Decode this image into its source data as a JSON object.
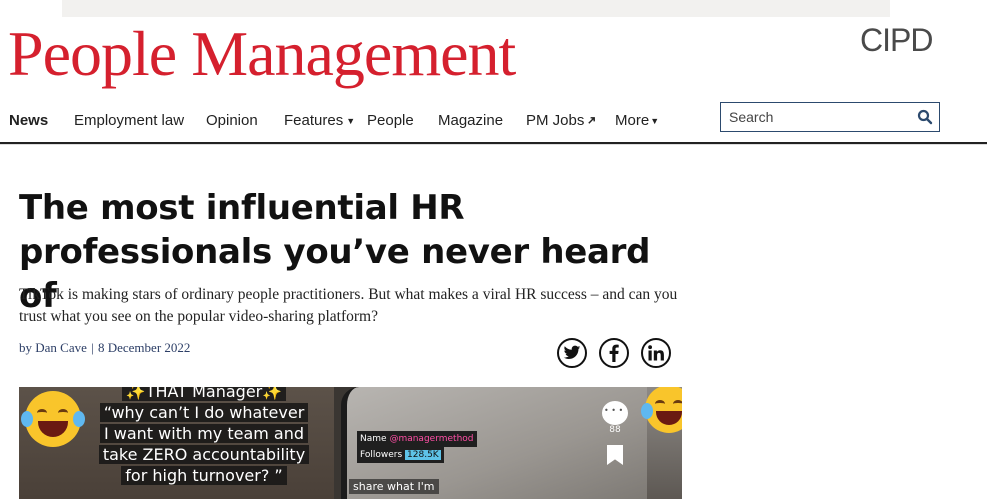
{
  "brand": {
    "logo_text": "People Management",
    "partner_logo": "CIPD",
    "logo_color": "#d5202e"
  },
  "nav": {
    "items": [
      {
        "label": "News",
        "active": true
      },
      {
        "label": "Employment law"
      },
      {
        "label": "Opinion"
      },
      {
        "label": "Features",
        "has_dropdown": true
      },
      {
        "label": "People"
      },
      {
        "label": "Magazine"
      },
      {
        "label": "PM Jobs",
        "icon": "external-link-icon"
      },
      {
        "label": "More",
        "has_dropdown": true
      }
    ]
  },
  "search": {
    "placeholder": "Search",
    "icon": "search-icon"
  },
  "article": {
    "title": "The most influential HR professionals you’ve never heard of",
    "standfirst": "TikTok is making stars of ordinary people practitioners. But what makes a viral HR success – and can you trust what you see on the popular video-sharing platform?",
    "byline_prefix": "by",
    "author": "Dan Cave",
    "date": "8 December 2022",
    "share": [
      {
        "network": "twitter",
        "icon": "twitter-icon"
      },
      {
        "network": "facebook",
        "icon": "facebook-icon"
      },
      {
        "network": "linkedin",
        "icon": "linkedin-icon"
      }
    ]
  },
  "hero_image": {
    "caption_lines": [
      "✨THAT Manager✨",
      "“why can’t I do whatever",
      "I want with my team and",
      "take ZERO accountability",
      "for high turnover? ”"
    ],
    "name_label": "Name",
    "name_value": "@managermethod",
    "followers_label": "Followers",
    "followers_value": "128.5K",
    "comment_count": "88",
    "share_text": "share what I'm"
  }
}
